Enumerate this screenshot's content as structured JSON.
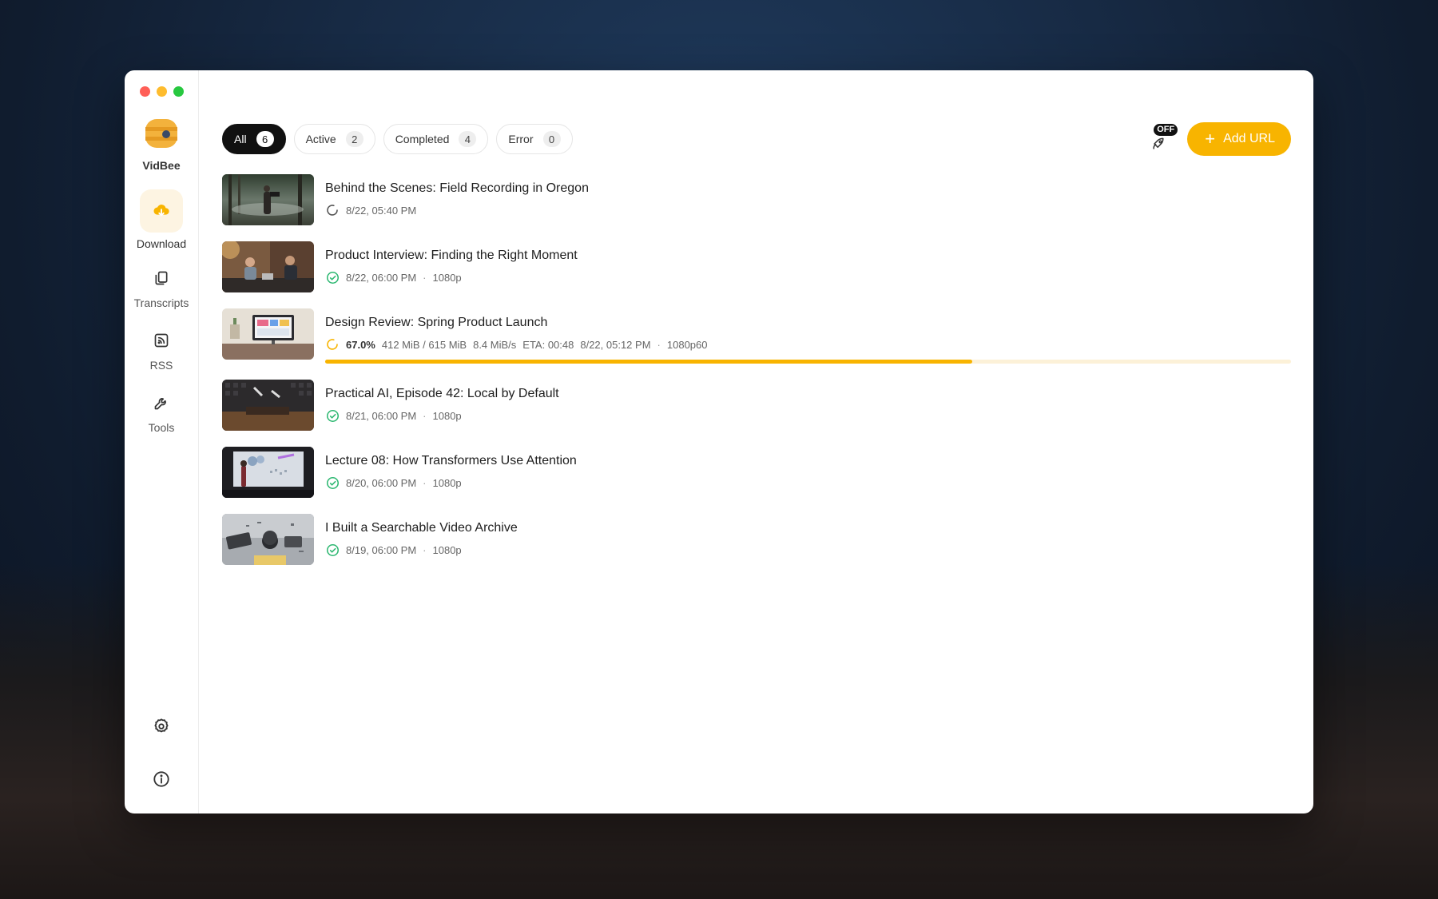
{
  "app": {
    "name": "VidBee"
  },
  "sidebar": {
    "items": [
      {
        "label": "Download",
        "icon": "download-cloud-icon",
        "active": true
      },
      {
        "label": "Transcripts",
        "icon": "transcripts-icon",
        "active": false
      },
      {
        "label": "RSS",
        "icon": "rss-icon",
        "active": false
      },
      {
        "label": "Tools",
        "icon": "wrench-icon",
        "active": false
      }
    ],
    "bottom": [
      {
        "icon": "gear-icon"
      },
      {
        "icon": "info-icon"
      }
    ]
  },
  "tabs": [
    {
      "label": "All",
      "count": "6",
      "active": true
    },
    {
      "label": "Active",
      "count": "2",
      "active": false
    },
    {
      "label": "Completed",
      "count": "4",
      "active": false
    },
    {
      "label": "Error",
      "count": "0",
      "active": false
    }
  ],
  "toolbar": {
    "rocket_badge": "OFF",
    "add_url_label": "Add URL"
  },
  "colors": {
    "accent": "#f8b400",
    "success": "#2eb872"
  },
  "downloads": [
    {
      "title": "Behind the Scenes: Field Recording in Oregon",
      "status": "pending",
      "date": "8/22, 05:40 PM"
    },
    {
      "title": "Product Interview: Finding the Right Moment",
      "status": "completed",
      "date": "8/22, 06:00 PM",
      "quality": "1080p"
    },
    {
      "title": "Design Review: Spring Product Launch",
      "status": "downloading",
      "percent": "67.0%",
      "size": "412 MiB / 615 MiB",
      "speed": "8.4 MiB/s",
      "eta": "ETA: 00:48",
      "date": "8/22, 05:12 PM",
      "quality": "1080p60",
      "progress": 0.67
    },
    {
      "title": "Practical AI, Episode 42: Local by Default",
      "status": "completed",
      "date": "8/21, 06:00 PM",
      "quality": "1080p"
    },
    {
      "title": "Lecture 08: How Transformers Use Attention",
      "status": "completed",
      "date": "8/20, 06:00 PM",
      "quality": "1080p"
    },
    {
      "title": "I Built a Searchable Video Archive",
      "status": "completed",
      "date": "8/19, 06:00 PM",
      "quality": "1080p"
    }
  ]
}
